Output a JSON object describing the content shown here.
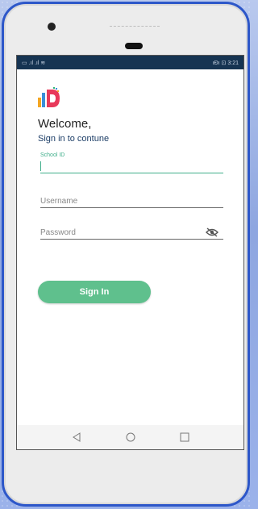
{
  "status_bar": {
    "left_text": "▭ .ıl .ıl ≋",
    "right_text": "ıĐı ⊡ 3:21"
  },
  "welcome": "Welcome,",
  "subtitle": "Sign in to contune",
  "fields": {
    "school_id_label": "School ID",
    "school_id_value": "",
    "username_placeholder": "Username",
    "password_placeholder": "Password"
  },
  "signin_button": "Sign In",
  "colors": {
    "accent": "#5fc08d",
    "status_bar": "#163452",
    "phone_frame": "#2d57c9"
  },
  "icons": [
    "back-icon",
    "home-icon",
    "recents-icon",
    "eye-off-icon"
  ]
}
